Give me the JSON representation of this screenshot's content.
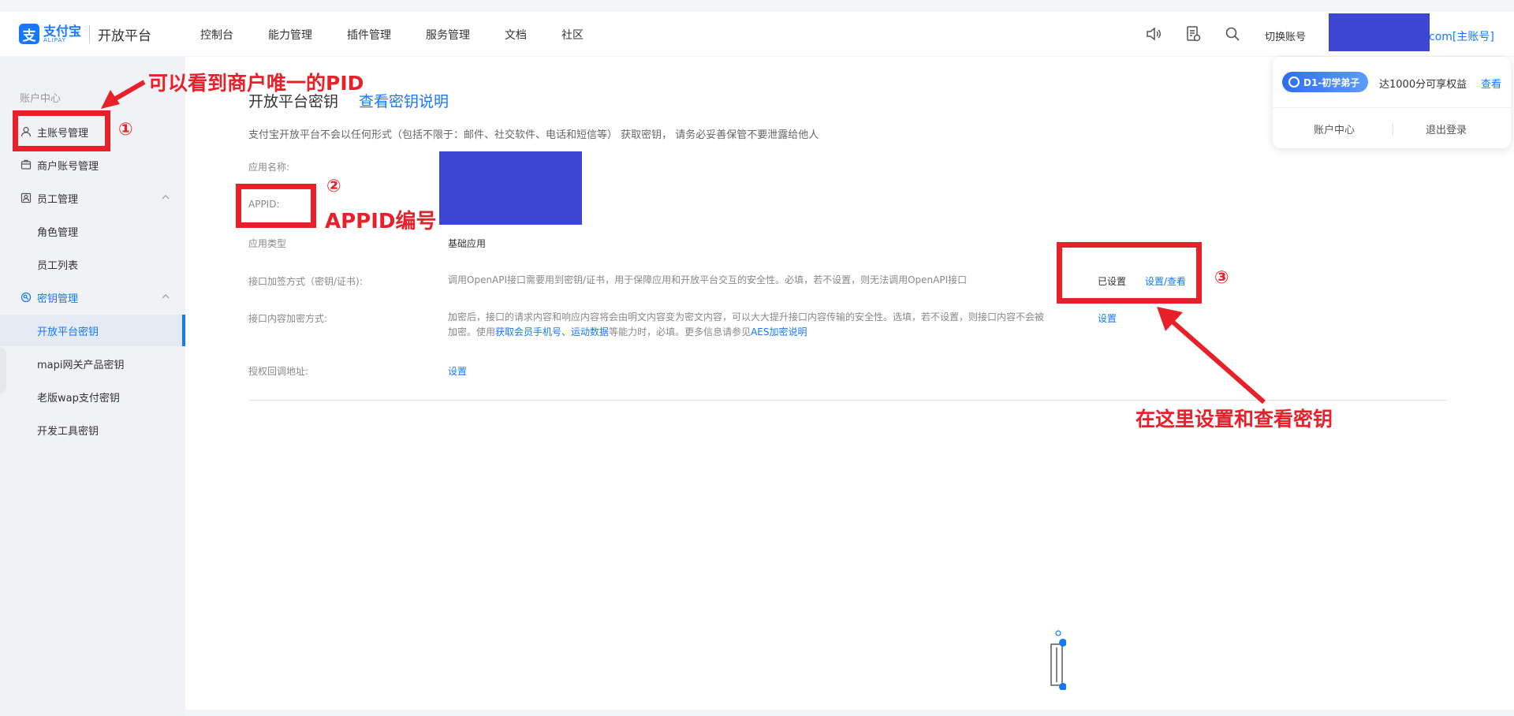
{
  "header": {
    "logo_cn": "支付宝",
    "logo_en": "ALIPAY",
    "platform": "开放平台",
    "nav": [
      "控制台",
      "能力管理",
      "插件管理",
      "服务管理",
      "文档",
      "社区"
    ],
    "switch_account": "切换账号",
    "account_suffix": "com[主账号]"
  },
  "sidebar": {
    "heading": "账户中心",
    "items": [
      {
        "label": "主账号管理"
      },
      {
        "label": "商户账号管理"
      },
      {
        "label": "员工管理"
      },
      {
        "label": "角色管理"
      },
      {
        "label": "员工列表"
      },
      {
        "label": "密钥管理"
      },
      {
        "label": "开放平台密钥"
      },
      {
        "label": "mapi网关产品密钥"
      },
      {
        "label": "老版wap支付密钥"
      },
      {
        "label": "开发工具密钥"
      }
    ]
  },
  "main": {
    "title": "开放平台密钥",
    "title_link": "查看密钥说明",
    "notice": "支付宝开放平台不会以任何形式（包括不限于：邮件、社交软件、电话和短信等） 获取密钥， 请务必妥善保管不要泄露给他人",
    "app_name_label": "应用名称:",
    "appid_label": "APPID:",
    "app_type_label": "应用类型",
    "app_type_value": "基础应用",
    "sign_label": "接口加签方式（密钥/证书):",
    "sign_desc": "调用OpenAPI接口需要用到密钥/证书，用于保障应用和开放平台交互的安全性。必填，若不设置，则无法调用OpenAPI接口",
    "sign_status": "已设置",
    "sign_action": "设置/查看",
    "encrypt_label": "接口内容加密方式:",
    "encrypt_desc_1": "加密后，接口的请求内容和响应内容将会由明文内容变为密文内容，可以大大提升接口内容传输的安全性。选填，若不设置，则接口内容不会被",
    "encrypt_desc_2a": "加密。使用",
    "encrypt_link_1": "获取会员手机号",
    "encrypt_sep": "、",
    "encrypt_link_2": "运动数据",
    "encrypt_desc_2b": "等能力时，必填。更多信息请参见",
    "encrypt_link_3": "AES加密说明",
    "encrypt_action": "设置",
    "callback_label": "授权回调地址:",
    "callback_action": "设置"
  },
  "popover": {
    "badge": "D1-初学弟子",
    "benefit": "达1000分可享权益",
    "view": "查看",
    "account_center": "账户中心",
    "logout": "退出登录"
  },
  "annotations": {
    "pid_note": "可以看到商户唯一的PID",
    "num1": "①",
    "num2": "②",
    "appid_note": "APPID编号",
    "num3": "③",
    "key_note": "在这里设置和查看密钥"
  },
  "colors": {
    "brand": "#1677ff",
    "annotation": "#e8202a",
    "redaction": "#3c46d0"
  }
}
